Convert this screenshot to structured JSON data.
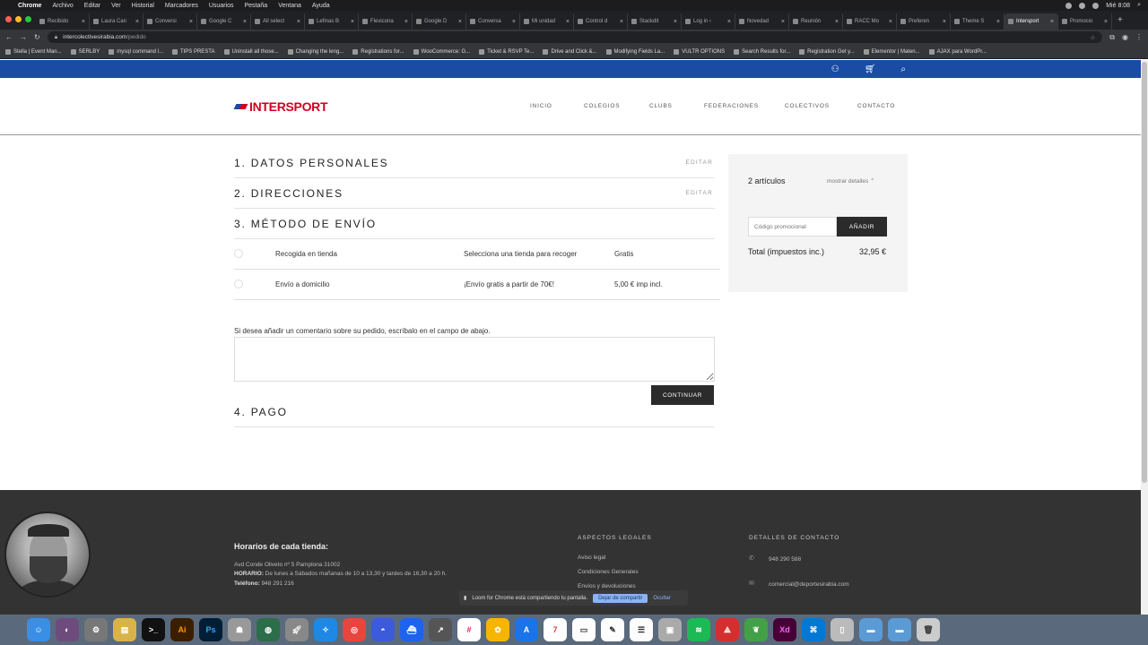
{
  "mac": {
    "menus": [
      "Chrome",
      "Archivo",
      "Editar",
      "Ver",
      "Historial",
      "Marcadores",
      "Usuarios",
      "Pestaña",
      "Ventana",
      "Ayuda"
    ],
    "clock": "Mié 8:08"
  },
  "browser": {
    "tabs": [
      "Recibido",
      "Laura Can",
      "Conversi",
      "Google C",
      "All select",
      "Lefinas B",
      "Flexicona",
      "Google D",
      "Conversa",
      "Mi unidad",
      "Control d",
      "Stackdit",
      "Log in ‹",
      "Novedad",
      "Reunión",
      "RACC Mo",
      "Preferen",
      "Theme S",
      "Intersport",
      "Promocio"
    ],
    "active_tab_index": 18,
    "url_host": "intercolectivesirabia.com",
    "url_path": "/pedido",
    "bookmarks": [
      "Stella | Event Man...",
      "SERLBY",
      "mysql command l...",
      "TIPS PRESTA",
      "Uninstall all those...",
      "Changing the leng...",
      "Registrations for...",
      "WooCommerce: G...",
      "Ticket & RSVP Te...",
      "Drive and Click &...",
      "Modifying Fields La...",
      "VULTR OPTIONS",
      "Search Results for...",
      "Registration Get y...",
      "Elementor | Maten...",
      "AJAX para WordPr..."
    ]
  },
  "site": {
    "brand": "INTERSPORT",
    "nav": [
      "INICIO",
      "COLEGIOS",
      "CLUBS",
      "FEDERACIONES",
      "COLECTIVOS",
      "CONTACTO"
    ],
    "accent": "#1a4ba5",
    "brand_red": "#d2001f"
  },
  "checkout": {
    "steps": [
      {
        "title": "1. DATOS PERSONALES",
        "edit": "EDITAR"
      },
      {
        "title": "2. DIRECCIONES",
        "edit": "EDITAR"
      },
      {
        "title": "3. MÉTODO DE ENVÍO",
        "edit": ""
      }
    ],
    "shipping": [
      {
        "name": "Recogida en tienda",
        "desc": "Selecciona una tienda para recoger",
        "price": "Gratis"
      },
      {
        "name": "Envío a domicilio",
        "desc": "¡Envío gratis a partir de 70€!",
        "price": "5,00 € imp incl."
      }
    ],
    "comment_label": "Si desea añadir un comentario sobre su pedido, escríbalo en el campo de abajo.",
    "continue": "CONTINUAR",
    "pago": "4. PAGO"
  },
  "summary": {
    "count": "2 artículos",
    "details": "mostrar detalles ⌃",
    "promo_placeholder": "Código promocional",
    "promo_btn": "AÑADIR",
    "total_label": "Total (impuestos inc.)",
    "total_value": "32,95 €"
  },
  "footer": {
    "hours_title": "Horarios de cada tienda:",
    "address": "Avd Conde Oliveto nº 5 Pamplona 31002",
    "horario_label": "HORARIO:",
    "horario": " De lunes a Sábados mañanas de 10 a 13,30 y tardes de 16,30 a 20 h.",
    "tel_label": "Teléfono:",
    "tel": " 948 291 216",
    "legal_title": "ASPECTOS LEGALES",
    "legal_links": [
      "Aviso legal",
      "Condiciones Generales",
      "Envíos y devoluciones"
    ],
    "contact_title": "DETALLES DE CONTACTO",
    "phone": "948 290 588",
    "email": "comercial@deportesirabia.com"
  },
  "share_banner": {
    "text": "Loom for Chrome está compartiendo tu pantalla.",
    "stop": "Dejar de compartir",
    "hide": "Ocultar"
  }
}
